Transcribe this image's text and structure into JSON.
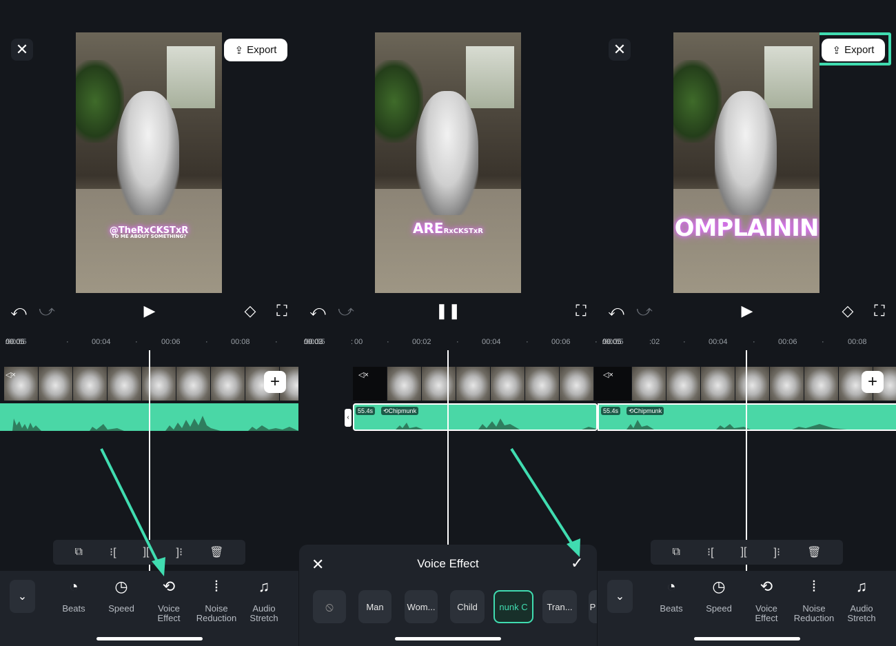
{
  "export_label": "Export",
  "panel1": {
    "caption_handle": "@TheRxCKSTxR",
    "caption_sub": "TO ME ABOUT SOMETHING?",
    "time_current": "00:05",
    "time_total": "/00:55",
    "ticks": [
      "00:04",
      "00:06",
      "00:08"
    ]
  },
  "panel2": {
    "caption_word": "ARE",
    "caption_handle": "RxCKSTxR",
    "time_current": "00:03",
    "time_total": "/00:55",
    "tick_clip": "00",
    "ticks": [
      "00:02",
      "00:04",
      "00:06"
    ],
    "badge_duration": "55.4s",
    "badge_effect": "Chipmunk",
    "voice_effect": {
      "title": "Voice Effect",
      "options": [
        "Man",
        "Wom...",
        "Child",
        "nunk C",
        "Tran...",
        "P"
      ],
      "selected": "nunk C"
    }
  },
  "panel3": {
    "caption_word": "OMPLAININ",
    "time_current": "00:05",
    "time_total": "/00:55",
    "tick_clip": "02",
    "ticks": [
      "00:04",
      "00:06",
      "00:08"
    ],
    "badge_duration": "55.4s",
    "badge_effect": "Chipmunk"
  },
  "tools": [
    {
      "icon": "beats-icon",
      "label": "Beats"
    },
    {
      "icon": "speed-icon",
      "label": "Speed"
    },
    {
      "icon": "voice-effect-icon",
      "label": "Voice\nEffect"
    },
    {
      "icon": "noise-reduction-icon",
      "label": "Noise\nReduction"
    },
    {
      "icon": "audio-stretch-icon",
      "label": "Audio\nStretch"
    }
  ],
  "colors": {
    "accent": "#40dcb0",
    "audio_track": "#4ad7a6",
    "background": "#14171c",
    "caption_glow": "#e06cff"
  }
}
